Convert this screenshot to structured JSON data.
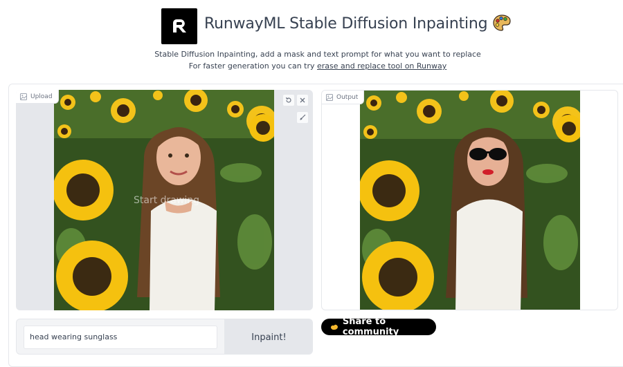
{
  "header": {
    "title": "RunwayML Stable Diffusion Inpainting",
    "title_emoji": "palette-emoji",
    "subtitle_line1": "Stable Diffusion Inpainting, add a mask and text prompt for what you want to replace",
    "subtitle_line2_prefix": "For faster generation you can try ",
    "subtitle_link": "erase and replace tool on Runway"
  },
  "upload_panel": {
    "label": "Upload",
    "label_icon": "image-icon",
    "tools": [
      "undo-icon",
      "clear-icon",
      "brush-icon"
    ],
    "overlay_text": "Start drawing"
  },
  "output_panel": {
    "label": "Output",
    "label_icon": "image-icon"
  },
  "prompt": {
    "value": "head wearing sunglass",
    "button_label": "Inpaint!"
  },
  "share": {
    "label": "Share to community",
    "icon": "hands-icon"
  },
  "colors": {
    "accent_dark": "#000000",
    "panel_bg": "#e5e7eb",
    "border": "#e5e7eb",
    "text": "#374151",
    "sunflower_yellow": "#f5c518",
    "foliage_green": "#3e6b2a"
  }
}
